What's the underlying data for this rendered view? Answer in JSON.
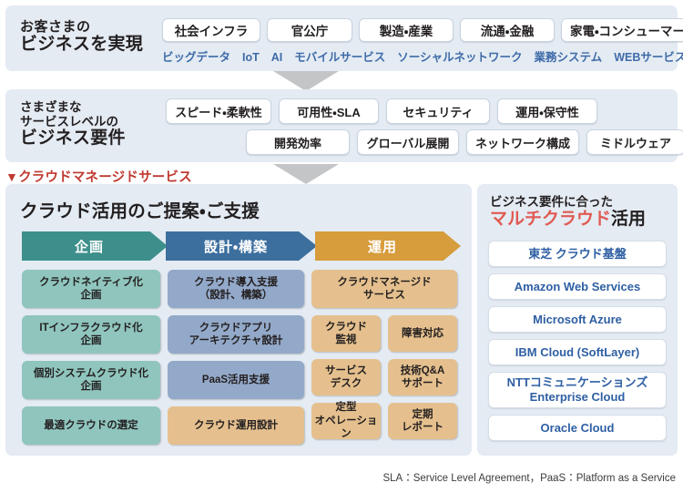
{
  "section_customer": {
    "label_line1": "お客さまの",
    "label_line2": "ビジネスを実現",
    "industries": [
      "社会インフラ",
      "官公庁",
      "製造・産業",
      "流通・金融",
      "家電・コンシューマー"
    ],
    "keywords": [
      "ビッグデータ",
      "IoT",
      "AI",
      "モバイルサービス",
      "ソーシャルネットワーク",
      "業務システム",
      "WEBサービス"
    ]
  },
  "section_requirements": {
    "label_line1": "さまざまな",
    "label_line2": "サービスレベルの",
    "label_line3": "ビジネス要件",
    "row1": [
      "スピード・柔軟性",
      "可用性・SLA",
      "セキュリティ",
      "運用・保守性"
    ],
    "row2": [
      "開発効率",
      "グローバル展開",
      "ネットワーク構成",
      "ミドルウェア"
    ]
  },
  "managed_service_caption": {
    "marker": "▼",
    "text": "クラウドマネージドサービス"
  },
  "section_main": {
    "title": "クラウド活用のご提案・ご支援",
    "phases": [
      {
        "label": "企画",
        "color": "#3d8f8b"
      },
      {
        "label": "設計・構築",
        "color": "#3d6f9e"
      },
      {
        "label": "運用",
        "color": "#d79c3c"
      }
    ],
    "column_plan": [
      "クラウドネイティブ化\n企画",
      "ITインフラクラウド化\n企画",
      "個別システムクラウド化\n企画",
      "最適クラウドの選定"
    ],
    "column_build": [
      "クラウド導入支援\n（設計、構築）",
      "クラウドアプリ\nアーキテクチャ設計",
      "PaaS活用支援",
      "クラウド運用設計"
    ],
    "column_ops_full": "クラウドマネージド\nサービス",
    "column_ops_pairs": [
      [
        "クラウド\n監視",
        "障害対応"
      ],
      [
        "サービス\nデスク",
        "技術Q&A\nサポート"
      ],
      [
        "定型\nオペレーション",
        "定期\nレポート"
      ]
    ]
  },
  "section_cloud": {
    "head_line1": "ビジネス要件に合った",
    "head_line2_highlight": "マルチクラウド",
    "head_line2_rest": "活用",
    "highlight_color": "#e05a52",
    "items": [
      "東芝 クラウド基盤",
      "Amazon Web Services",
      "Microsoft Azure",
      "IBM Cloud (SoftLayer)",
      "NTTコミュニケーションズ\nEnterprise Cloud",
      "Oracle Cloud"
    ]
  },
  "footnote": "SLA：Service Level Agreement，PaaS：Platform as a Service"
}
